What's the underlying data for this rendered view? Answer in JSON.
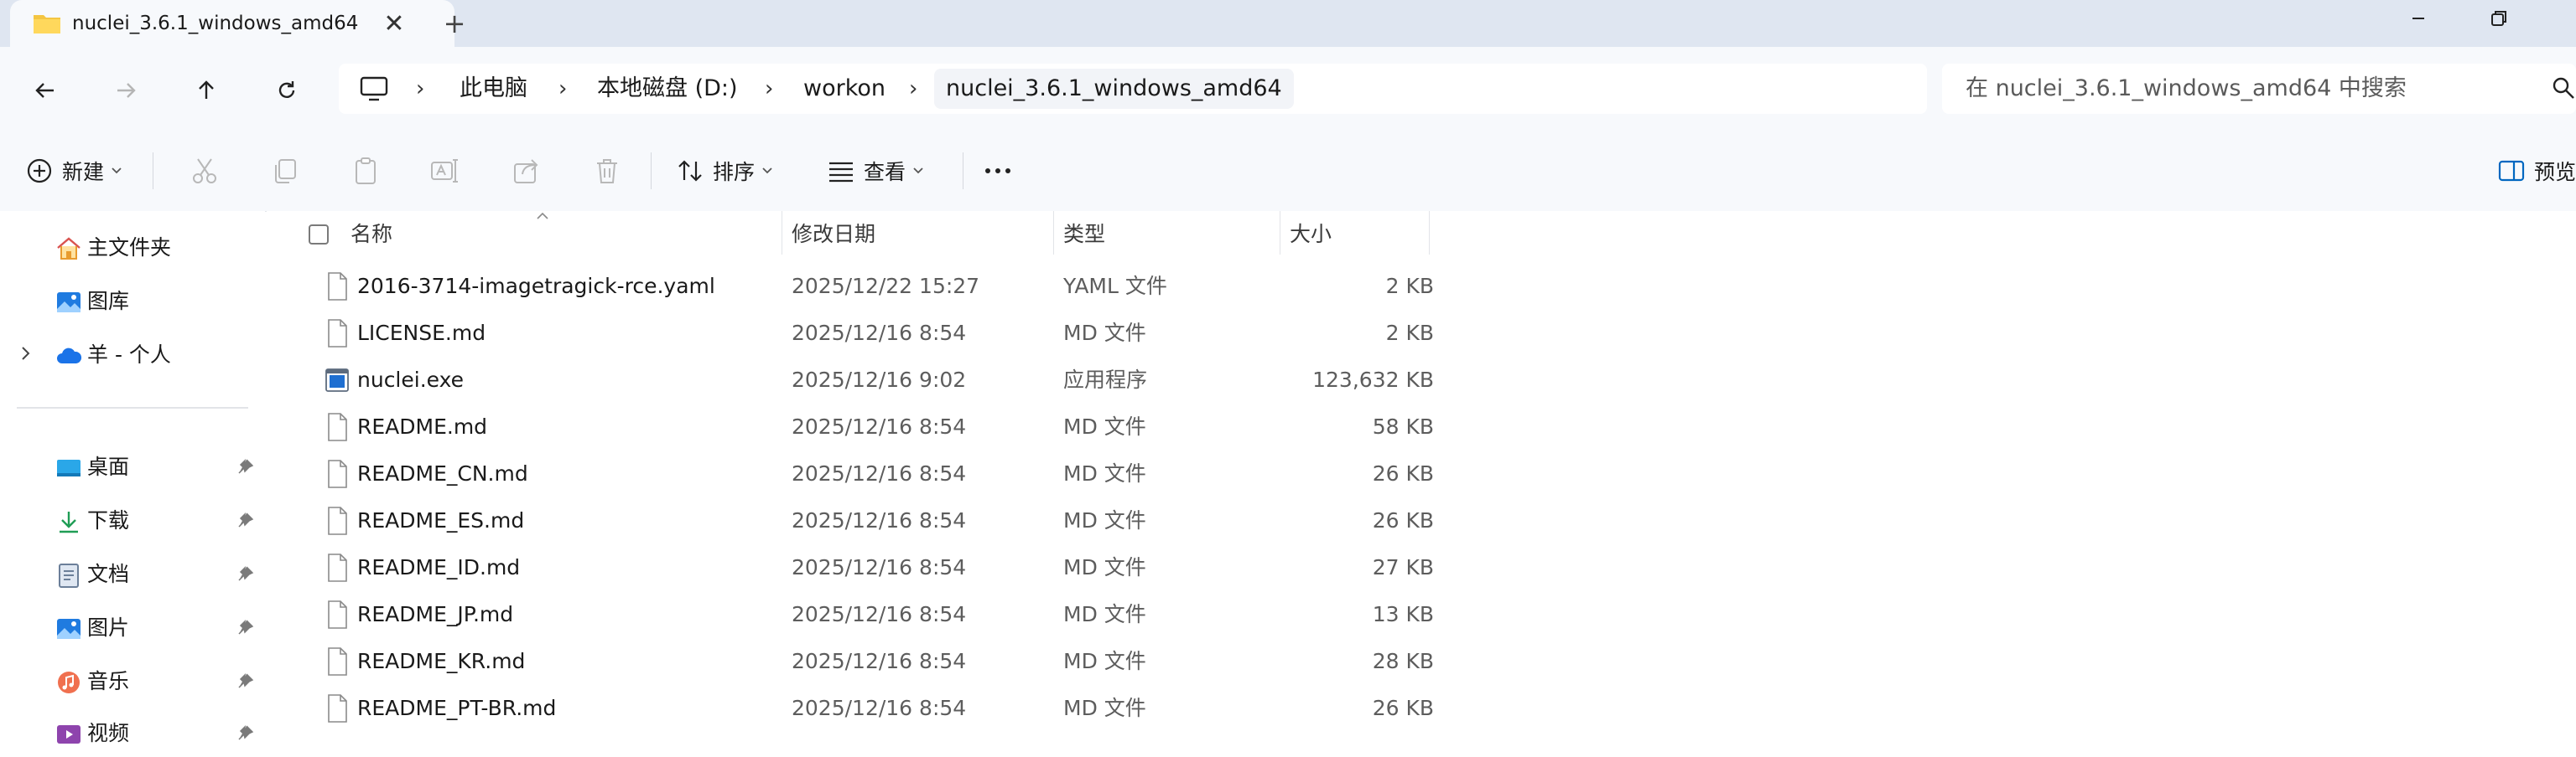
{
  "tab": {
    "title": "nuclei_3.6.1_windows_amd64",
    "close_glyph": "✕",
    "new_tab_glyph": "+"
  },
  "breadcrumb": [
    "此电脑",
    "本地磁盘 (D:)",
    "workon",
    "nuclei_3.6.1_windows_amd64"
  ],
  "breadcrumb_separator": "›",
  "search": {
    "placeholder": "在 nuclei_3.6.1_windows_amd64 中搜索"
  },
  "toolbar": {
    "new_label": "新建",
    "sort_label": "排序",
    "view_label": "查看",
    "preview_label": "预览"
  },
  "sidebar": {
    "top_items": [
      {
        "label": "主文件夹",
        "icon": "home-icon"
      },
      {
        "label": "图库",
        "icon": "gallery-icon"
      },
      {
        "label": "羊 - 个人",
        "icon": "onedrive-cloud-icon"
      }
    ],
    "pinned_items": [
      {
        "label": "桌面",
        "icon": "desktop-icon"
      },
      {
        "label": "下载",
        "icon": "download-icon"
      },
      {
        "label": "文档",
        "icon": "documents-icon"
      },
      {
        "label": "图片",
        "icon": "pictures-icon"
      },
      {
        "label": "音乐",
        "icon": "music-icon"
      },
      {
        "label": "视频",
        "icon": "videos-icon"
      }
    ]
  },
  "columns": {
    "name": "名称",
    "date": "修改日期",
    "type": "类型",
    "size": "大小"
  },
  "files": [
    {
      "name": "2016-3714-imagetragick-rce.yaml",
      "date": "2025/12/22 15:27",
      "type": "YAML 文件",
      "size": "2 KB",
      "icon": "file-icon"
    },
    {
      "name": "LICENSE.md",
      "date": "2025/12/16 8:54",
      "type": "MD 文件",
      "size": "2 KB",
      "icon": "file-icon"
    },
    {
      "name": "nuclei.exe",
      "date": "2025/12/16 9:02",
      "type": "应用程序",
      "size": "123,632 KB",
      "icon": "exe-icon"
    },
    {
      "name": "README.md",
      "date": "2025/12/16 8:54",
      "type": "MD 文件",
      "size": "58 KB",
      "icon": "file-icon"
    },
    {
      "name": "README_CN.md",
      "date": "2025/12/16 8:54",
      "type": "MD 文件",
      "size": "26 KB",
      "icon": "file-icon"
    },
    {
      "name": "README_ES.md",
      "date": "2025/12/16 8:54",
      "type": "MD 文件",
      "size": "26 KB",
      "icon": "file-icon"
    },
    {
      "name": "README_ID.md",
      "date": "2025/12/16 8:54",
      "type": "MD 文件",
      "size": "27 KB",
      "icon": "file-icon"
    },
    {
      "name": "README_JP.md",
      "date": "2025/12/16 8:54",
      "type": "MD 文件",
      "size": "13 KB",
      "icon": "file-icon"
    },
    {
      "name": "README_KR.md",
      "date": "2025/12/16 8:54",
      "type": "MD 文件",
      "size": "28 KB",
      "icon": "file-icon"
    },
    {
      "name": "README_PT-BR.md",
      "date": "2025/12/16 8:54",
      "type": "MD 文件",
      "size": "26 KB",
      "icon": "file-icon"
    }
  ],
  "colors": {
    "accent": "#0067c0",
    "folder_yellow": "#f4c542",
    "chrome_bg": "#dfe6f1",
    "surface": "#f7f9fc"
  }
}
